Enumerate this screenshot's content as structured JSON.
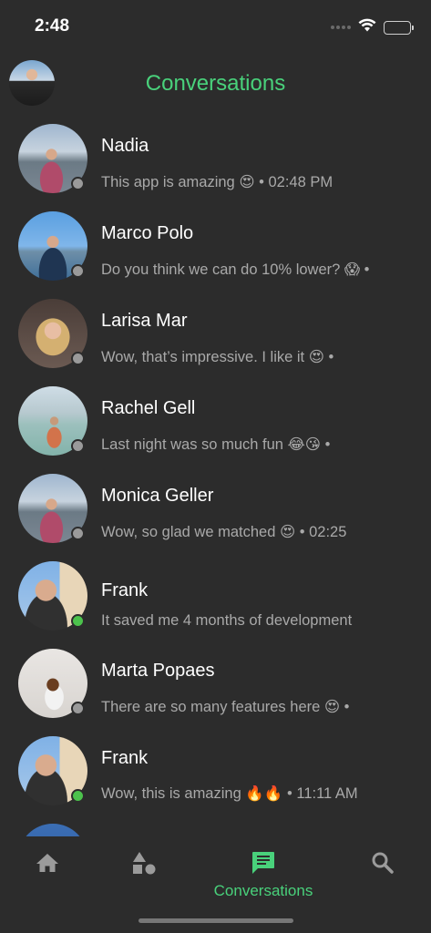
{
  "status_bar": {
    "time": "2:48",
    "icons": [
      "signal-icon",
      "wifi-icon",
      "battery-icon"
    ]
  },
  "header": {
    "title": "Conversations",
    "title_color": "#49d17b"
  },
  "conversations": [
    {
      "name": "Nadia",
      "preview": "This app is amazing 😍 • 02:48 PM",
      "status": "offline"
    },
    {
      "name": "Marco Polo",
      "preview": "Do you think we can do 10% lower? 😱 •",
      "status": "offline"
    },
    {
      "name": "Larisa Mar",
      "preview": "Wow, that’s impressive. I like it 😍 •",
      "status": "offline"
    },
    {
      "name": "Rachel Gell",
      "preview": "Last night was so much fun 😂😘 •",
      "status": "offline"
    },
    {
      "name": "Monica Geller",
      "preview": "Wow, so glad we matched 😍 • 02:25",
      "status": "offline"
    },
    {
      "name": "Frank",
      "preview": "It saved me 4 months of development",
      "status": "online"
    },
    {
      "name": "Marta Popaes",
      "preview": "There are so many features here 😍 •",
      "status": "offline"
    },
    {
      "name": "Frank",
      "preview": "Wow, this is amazing 🔥🔥 • 11:11 AM",
      "status": "online"
    }
  ],
  "tabbar": {
    "tabs": [
      {
        "icon": "home-icon",
        "label": "",
        "active": false
      },
      {
        "icon": "shapes-icon",
        "label": "",
        "active": false
      },
      {
        "icon": "chat-icon",
        "label": "Conversations",
        "active": true
      },
      {
        "icon": "search-icon",
        "label": "",
        "active": false
      }
    ]
  },
  "colors": {
    "background": "#2c2c2c",
    "accent": "#49d17b",
    "online": "#4cc24c",
    "offline": "#9a9a9a",
    "inactive_icon": "#9b9b9b"
  }
}
